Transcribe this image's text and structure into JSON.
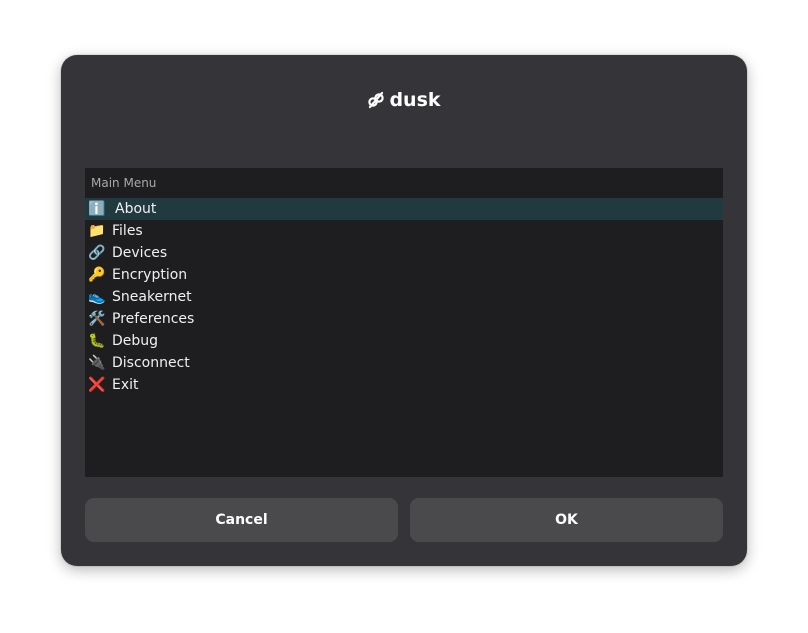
{
  "dialog": {
    "title": "dusk",
    "title_icon": "dusk-logo-icon"
  },
  "menu": {
    "header": "Main Menu",
    "selected_index": 0,
    "items": [
      {
        "icon": "ℹ️",
        "icon_name": "info-icon",
        "label": "About"
      },
      {
        "icon": "📁",
        "icon_name": "folder-icon",
        "label": "Files"
      },
      {
        "icon": "🔗",
        "icon_name": "link-icon",
        "label": "Devices"
      },
      {
        "icon": "🔑",
        "icon_name": "key-icon",
        "label": "Encryption"
      },
      {
        "icon": "👟",
        "icon_name": "sneaker-icon",
        "label": "Sneakernet"
      },
      {
        "icon": "🛠️",
        "icon_name": "tools-icon",
        "label": "Preferences"
      },
      {
        "icon": "🐛",
        "icon_name": "bug-icon",
        "label": "Debug"
      },
      {
        "icon": "🔌",
        "icon_name": "plug-icon",
        "label": "Disconnect"
      },
      {
        "icon": "❌",
        "icon_name": "cross-mark-icon",
        "label": "Exit"
      }
    ]
  },
  "buttons": {
    "cancel": "Cancel",
    "ok": "OK"
  },
  "colors": {
    "dialog_bg": "#353539",
    "panel_bg": "#1e1e21",
    "selected_row": "#213a3f",
    "button_bg": "#4a4a4d"
  }
}
